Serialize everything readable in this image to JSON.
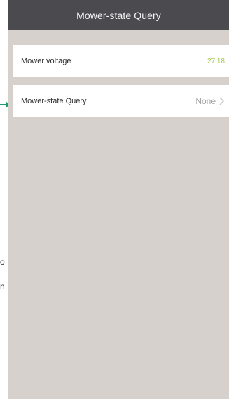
{
  "header": {
    "title": "Mower-state Query"
  },
  "rows": [
    {
      "label": "Mower voltage",
      "value": "27.18"
    },
    {
      "label": "Mower-state Query",
      "value": "None"
    }
  ],
  "icons": {
    "chevron": "chevron-right-icon",
    "pointer": "arrow-right-icon"
  },
  "colors": {
    "navbar": "#4a4a4f",
    "background": "#d6d1cc",
    "voltage_value": "#a0c94a",
    "pointer_arrow": "#1f9a6b"
  },
  "edge_text": [
    "o",
    "n"
  ]
}
